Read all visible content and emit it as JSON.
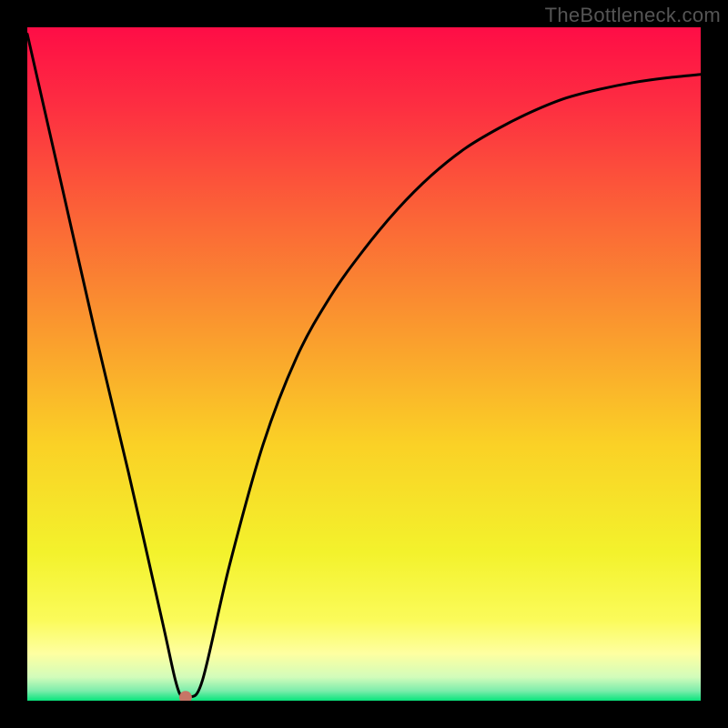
{
  "watermark": "TheBottleneck.com",
  "chart_data": {
    "type": "line",
    "title": "",
    "xlabel": "",
    "ylabel": "",
    "xlim": [
      0,
      100
    ],
    "ylim": [
      0,
      100
    ],
    "series": [
      {
        "name": "curve",
        "x": [
          0,
          5,
          10,
          15,
          20,
          22,
          23,
          24,
          26,
          30,
          35,
          40,
          45,
          50,
          55,
          60,
          65,
          70,
          75,
          80,
          85,
          90,
          95,
          100
        ],
        "values": [
          99,
          77,
          55,
          34,
          12,
          3,
          0.5,
          0.5,
          3,
          20,
          38,
          51,
          60,
          67,
          73,
          78,
          82,
          85,
          87.5,
          89.5,
          90.8,
          91.8,
          92.5,
          93
        ]
      }
    ],
    "marker": {
      "x": 23.5,
      "y": 0.5,
      "color": "#c77566",
      "radius_px": 7
    },
    "gradient_stops": [
      {
        "offset": 0.0,
        "color": "#fe0d46"
      },
      {
        "offset": 0.12,
        "color": "#fd2f41"
      },
      {
        "offset": 0.28,
        "color": "#fb6437"
      },
      {
        "offset": 0.45,
        "color": "#fa9a2e"
      },
      {
        "offset": 0.62,
        "color": "#fad126"
      },
      {
        "offset": 0.78,
        "color": "#f3f22c"
      },
      {
        "offset": 0.88,
        "color": "#fbfb5a"
      },
      {
        "offset": 0.93,
        "color": "#feffa1"
      },
      {
        "offset": 0.965,
        "color": "#d2fcba"
      },
      {
        "offset": 0.985,
        "color": "#7eedac"
      },
      {
        "offset": 1.0,
        "color": "#08e47c"
      }
    ],
    "grid": false,
    "legend": false
  }
}
